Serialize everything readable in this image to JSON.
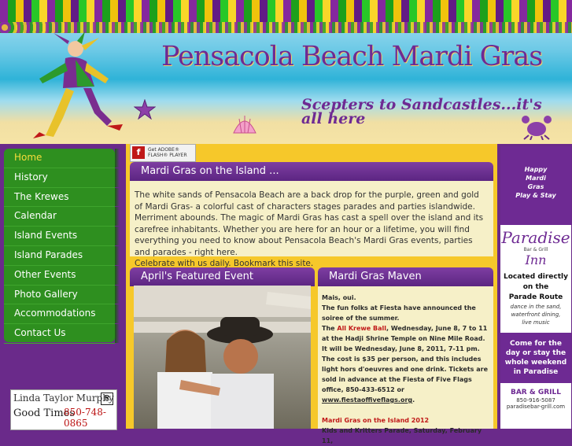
{
  "header": {
    "title": "Pensacola Beach Mardi Gras",
    "tagline": "Scepters to Sandcastles...it's all here"
  },
  "nav": {
    "items": [
      {
        "label": "Home",
        "active": true
      },
      {
        "label": "History"
      },
      {
        "label": "The Krewes"
      },
      {
        "label": "Calendar"
      },
      {
        "label": "Island Events"
      },
      {
        "label": "Island Parades"
      },
      {
        "label": "Other Events"
      },
      {
        "label": "Photo Gallery"
      },
      {
        "label": "Accommodations"
      },
      {
        "label": "Contact Us"
      }
    ]
  },
  "flash": {
    "line1": "Get ADOBE®",
    "line2": "FLASH® PLAYER"
  },
  "main": {
    "heading": "Mardi Gras on the Island ...",
    "body": "The white sands of Pensacola Beach are a back drop for the purple, green and gold of Mardi Gras- a colorful cast of characters stages parades and parties islandwide. Merriment abounds. The magic of Mardi Gras has cast a spell over the island and its carefree inhabitants. Whether you are here for an hour or a lifetime, you will find everything you need to know about Pensacola Beach's Mardi Gras events,  parties and parades - right here.",
    "body2": "Celebrate with us daily. Bookmark this site."
  },
  "event": {
    "heading": "April's Featured Event"
  },
  "maven": {
    "heading": "Mardi Gras Maven",
    "p1": "Mais, oui.",
    "p2": "The fun folks at Fiesta have announced the soiree of the summer.",
    "p3a": "The ",
    "p3b": "All Krewe Ball",
    "p3c": ", Wednesday, June 8, 7 to 11 at the Hadji Shrine Temple on Nine Mile Road.  It will be Wednesday, June 8, 2011, 7-11 pm.  The cost is $35 per person, and this includes light hors d'oeuvres and one drink.  Tickets are sold in advance at the Fiesta of Five Flags office, 850-433-6512 or ",
    "link": "www.fiestaoffiveflags.org",
    "p3d": ".",
    "p4": "Mardi Gras on the Island 2012",
    "p5": "Kids and Kritters Parade, Saturday, February 11,"
  },
  "realtor": {
    "name": "Linda Taylor Murphy",
    "phone": "850-748-0865",
    "tag": "Good Times"
  },
  "ad": {
    "top1": "Happy",
    "top2": "Mardi",
    "top3": "Gras",
    "top4": "Play & Stay",
    "brand": "Paradise",
    "barline": "Bar & Grill",
    "inn": "Inn",
    "loc1": "Located directly",
    "loc2": "on the",
    "loc3": "Parade Route",
    "sub1": "dance in the sand,",
    "sub2": "waterfront dining,",
    "sub3": "live music",
    "promo1": "Come for the",
    "promo2": "day or stay the",
    "promo3": "whole weekend",
    "promo4": "in Paradise",
    "bg": "BAR & GRILL",
    "phone": "850-916-5087",
    "web": "paradisebar-grill.com"
  },
  "colors": {
    "purple": "#6e2a93",
    "green": "#2e8f1f",
    "gold": "#f6c82a"
  }
}
